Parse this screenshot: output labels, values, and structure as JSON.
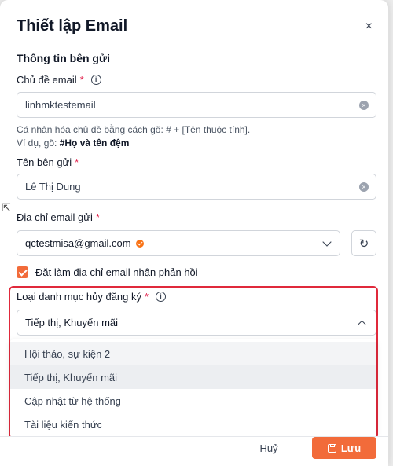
{
  "dialog": {
    "title": "Thiết lập Email",
    "close_symbol": "×"
  },
  "sender_section": {
    "title": "Thông tin bên gửi",
    "subject": {
      "label": "Chủ đề email",
      "required_mark": "*",
      "info_symbol": "i",
      "value": "linhmktestemail"
    },
    "hint_line1": "Cá nhân hóa chủ đề bằng cách gõ: # + [Tên thuộc tính].",
    "hint_line2_prefix": "Ví dụ, gõ: ",
    "hint_line2_example": "#Họ và tên đệm",
    "sender_name": {
      "label": "Tên bên gửi",
      "required_mark": "*",
      "value": "Lê Thị Dung"
    },
    "sender_email": {
      "label": "Địa chỉ email gửi",
      "required_mark": "*",
      "value": "qctestmisa@gmail.com",
      "verified_icon": "verified-badge-icon",
      "refresh_icon": "refresh-icon"
    },
    "reply_checkbox": {
      "label": "Đặt làm địa chỉ email nhận phản hồi",
      "checked": true
    }
  },
  "unsubscribe": {
    "label": "Loại danh mục hủy đăng ký",
    "required_mark": "*",
    "info_symbol": "i",
    "selected_value": "Tiếp thị, Khuyến mãi",
    "options": [
      "Hội thảo, sự kiện 2",
      "Tiếp thị, Khuyến mãi",
      "Cập nhật từ hệ thống",
      "Tài liệu kiến thức"
    ]
  },
  "footer": {
    "cancel_label": "Huỷ",
    "save_label": "Lưu"
  },
  "colors": {
    "accent": "#f26b3a",
    "highlight_border": "#e0293b",
    "required": "#e11d48"
  }
}
